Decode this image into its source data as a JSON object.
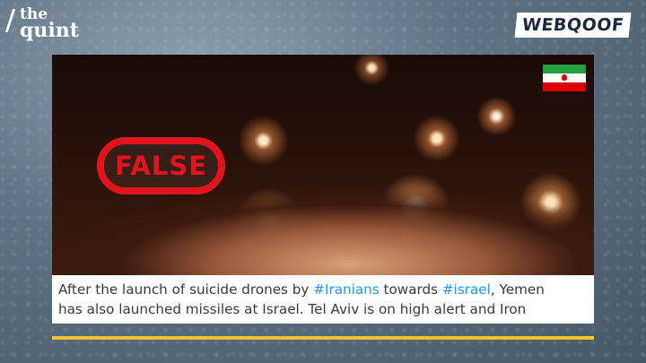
{
  "brand": {
    "line1": "the",
    "line2": "quint"
  },
  "badge": {
    "label": "WEBQOOF"
  },
  "stamp": {
    "label": "FALSE"
  },
  "flag": {
    "country": "Iran",
    "colors": [
      "#239f40",
      "#ffffff",
      "#da0000"
    ]
  },
  "caption": {
    "line1_a": "After the launch of suicide drones by ",
    "tag1": "#Iranians",
    "line1_b": " towards ",
    "tag2": "#israel",
    "line1_c": ", Yemen",
    "line2": "has also launched missiles at Israel. Tel Aviv is on high alert and Iron"
  },
  "colors": {
    "stamp": "#e1141e",
    "hashtag": "#1d9bf0",
    "underline": "#f2c12e"
  }
}
